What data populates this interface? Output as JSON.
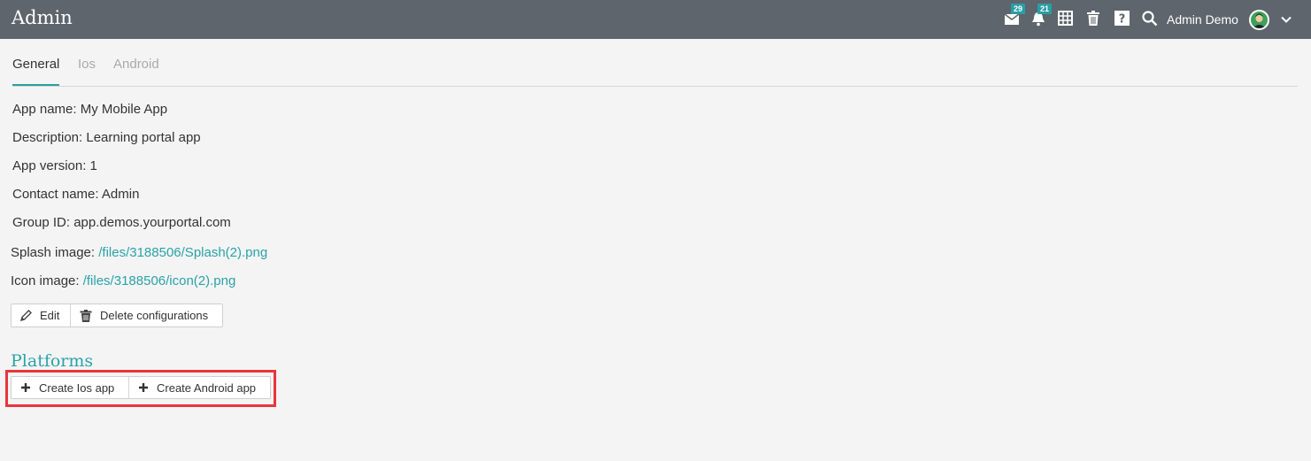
{
  "header": {
    "title": "Admin",
    "messages_badge": "29",
    "notifications_badge": "21",
    "user_name": "Admin Demo"
  },
  "tabs": [
    {
      "label": "General",
      "active": true
    },
    {
      "label": "Ios",
      "active": false
    },
    {
      "label": "Android",
      "active": false
    }
  ],
  "details": {
    "app_name": "App name: My Mobile App",
    "description": "Description: Learning portal app",
    "app_version": "App version: 1",
    "contact_name": "Contact name: Admin",
    "group_id": "Group ID: app.demos.yourportal.com",
    "splash_label": "Splash image: ",
    "splash_link": "/files/3188506/Splash(2).png",
    "icon_label": "Icon image: ",
    "icon_link": "/files/3188506/icon(2).png"
  },
  "actions": {
    "edit_label": "Edit",
    "delete_label": "Delete configurations"
  },
  "platforms": {
    "title": "Platforms",
    "create_ios_label": "Create Ios app",
    "create_android_label": "Create Android app"
  },
  "colors": {
    "topbar": "#5e656c",
    "accent": "#2aa3a8",
    "highlight": "#e8353d",
    "background": "#f4f4f4"
  }
}
